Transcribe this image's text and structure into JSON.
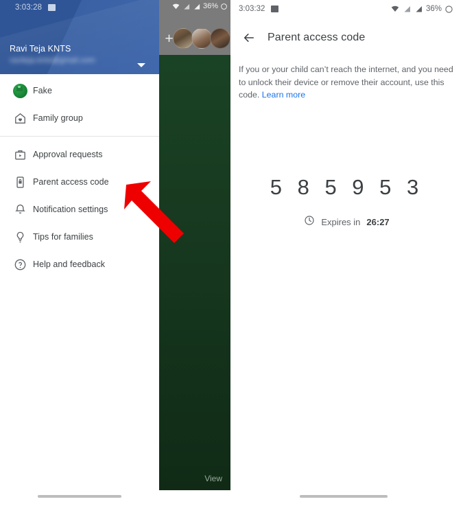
{
  "left_panel": {
    "status_bar": {
      "time": "3:03:28",
      "image_icon": "image-icon"
    },
    "account": {
      "name": "Ravi Teja KNTS",
      "email": "raviteja.knts@gmail.com",
      "caret_icon": "chevron-down-icon"
    },
    "menu_items": [
      {
        "label": "Fake",
        "icon": "profile-avatar-icon"
      },
      {
        "label": "Family group",
        "icon": "home-family-icon"
      },
      {
        "label": "Approval requests",
        "icon": "approval-play-icon"
      },
      {
        "label": "Parent access code",
        "icon": "phone-lock-icon"
      },
      {
        "label": "Notification settings",
        "icon": "bell-icon"
      },
      {
        "label": "Tips for families",
        "icon": "lightbulb-icon"
      },
      {
        "label": "Help and feedback",
        "icon": "help-circle-icon"
      }
    ],
    "header_color": "#2f5596"
  },
  "middle_panel": {
    "status_bar": {
      "battery_percent": "36%",
      "wifi_icon": "wifi-icon",
      "signal_icon": "signal-bars-icon"
    },
    "add_button": "+",
    "avatars": [
      "avatar-1",
      "avatar-2",
      "avatar-3"
    ],
    "view_label": "View",
    "background_color": "#17391f"
  },
  "right_panel": {
    "status_bar": {
      "time": "3:03:32",
      "battery_percent": "36%",
      "image_icon": "image-icon",
      "wifi_icon": "wifi-icon",
      "signal_icon": "signal-bars-icon",
      "battery_icon": "battery-circle-icon"
    },
    "app_bar": {
      "back_icon": "arrow-back-icon",
      "title": "Parent access code"
    },
    "description": "If you or your child can’t reach the internet, and you need to unlock their device or remove their account, use this code.",
    "learn_more": "Learn more",
    "learn_more_color": "#1a73e8",
    "device_icon": "phone-unlock-icon",
    "access_code": "5 8 5 9 5 3",
    "expiry_label": "Expires in",
    "expiry_time": "26:27",
    "clock_icon": "clock-icon"
  },
  "annotation": {
    "arrow": "red-arrow-pointing-to-parent-access-code",
    "color": "#ee0000"
  }
}
